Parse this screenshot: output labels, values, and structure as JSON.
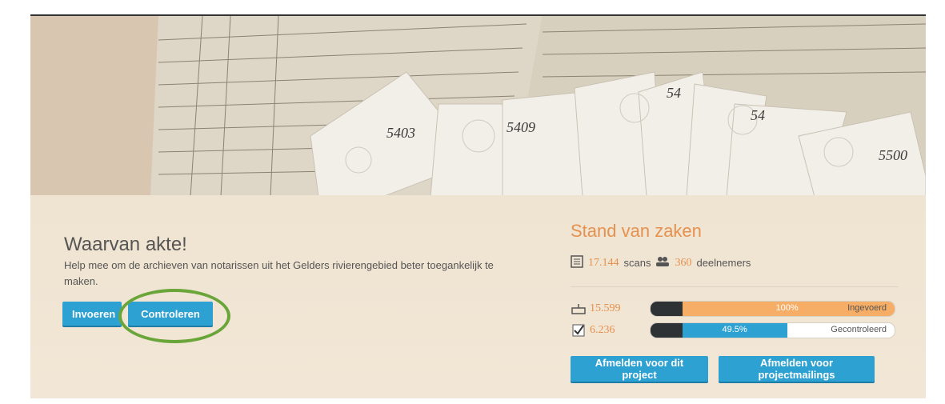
{
  "project": {
    "title": "Waarvan akte!",
    "description": "Help mee om de archieven van notarissen uit het Gelders rivierengebied beter toegankelijk te maken.",
    "buttons": {
      "invoeren": "Invoeren",
      "controleren": "Controleren"
    }
  },
  "stats": {
    "title": "Stand van zaken",
    "scans_count": "17.144",
    "scans_label": "scans",
    "participants_count": "360",
    "participants_label": "deelnemers",
    "entered": {
      "count": "15.599",
      "percent_label": "100%",
      "label": "Ingevoerd",
      "progress": 1.0,
      "color": "#f6ad65"
    },
    "checked": {
      "count": "6.236",
      "percent_label": "49.5%",
      "label": "Gecontroleerd",
      "progress": 0.495,
      "color": "#2ea1d3"
    }
  },
  "actions": {
    "unsubscribe_project": "Afmelden voor dit project",
    "unsubscribe_mailings": "Afmelden voor projectmailings"
  },
  "colors": {
    "accent": "#e5914f",
    "button": "#2ea1d3",
    "highlight": "#6aa539"
  }
}
